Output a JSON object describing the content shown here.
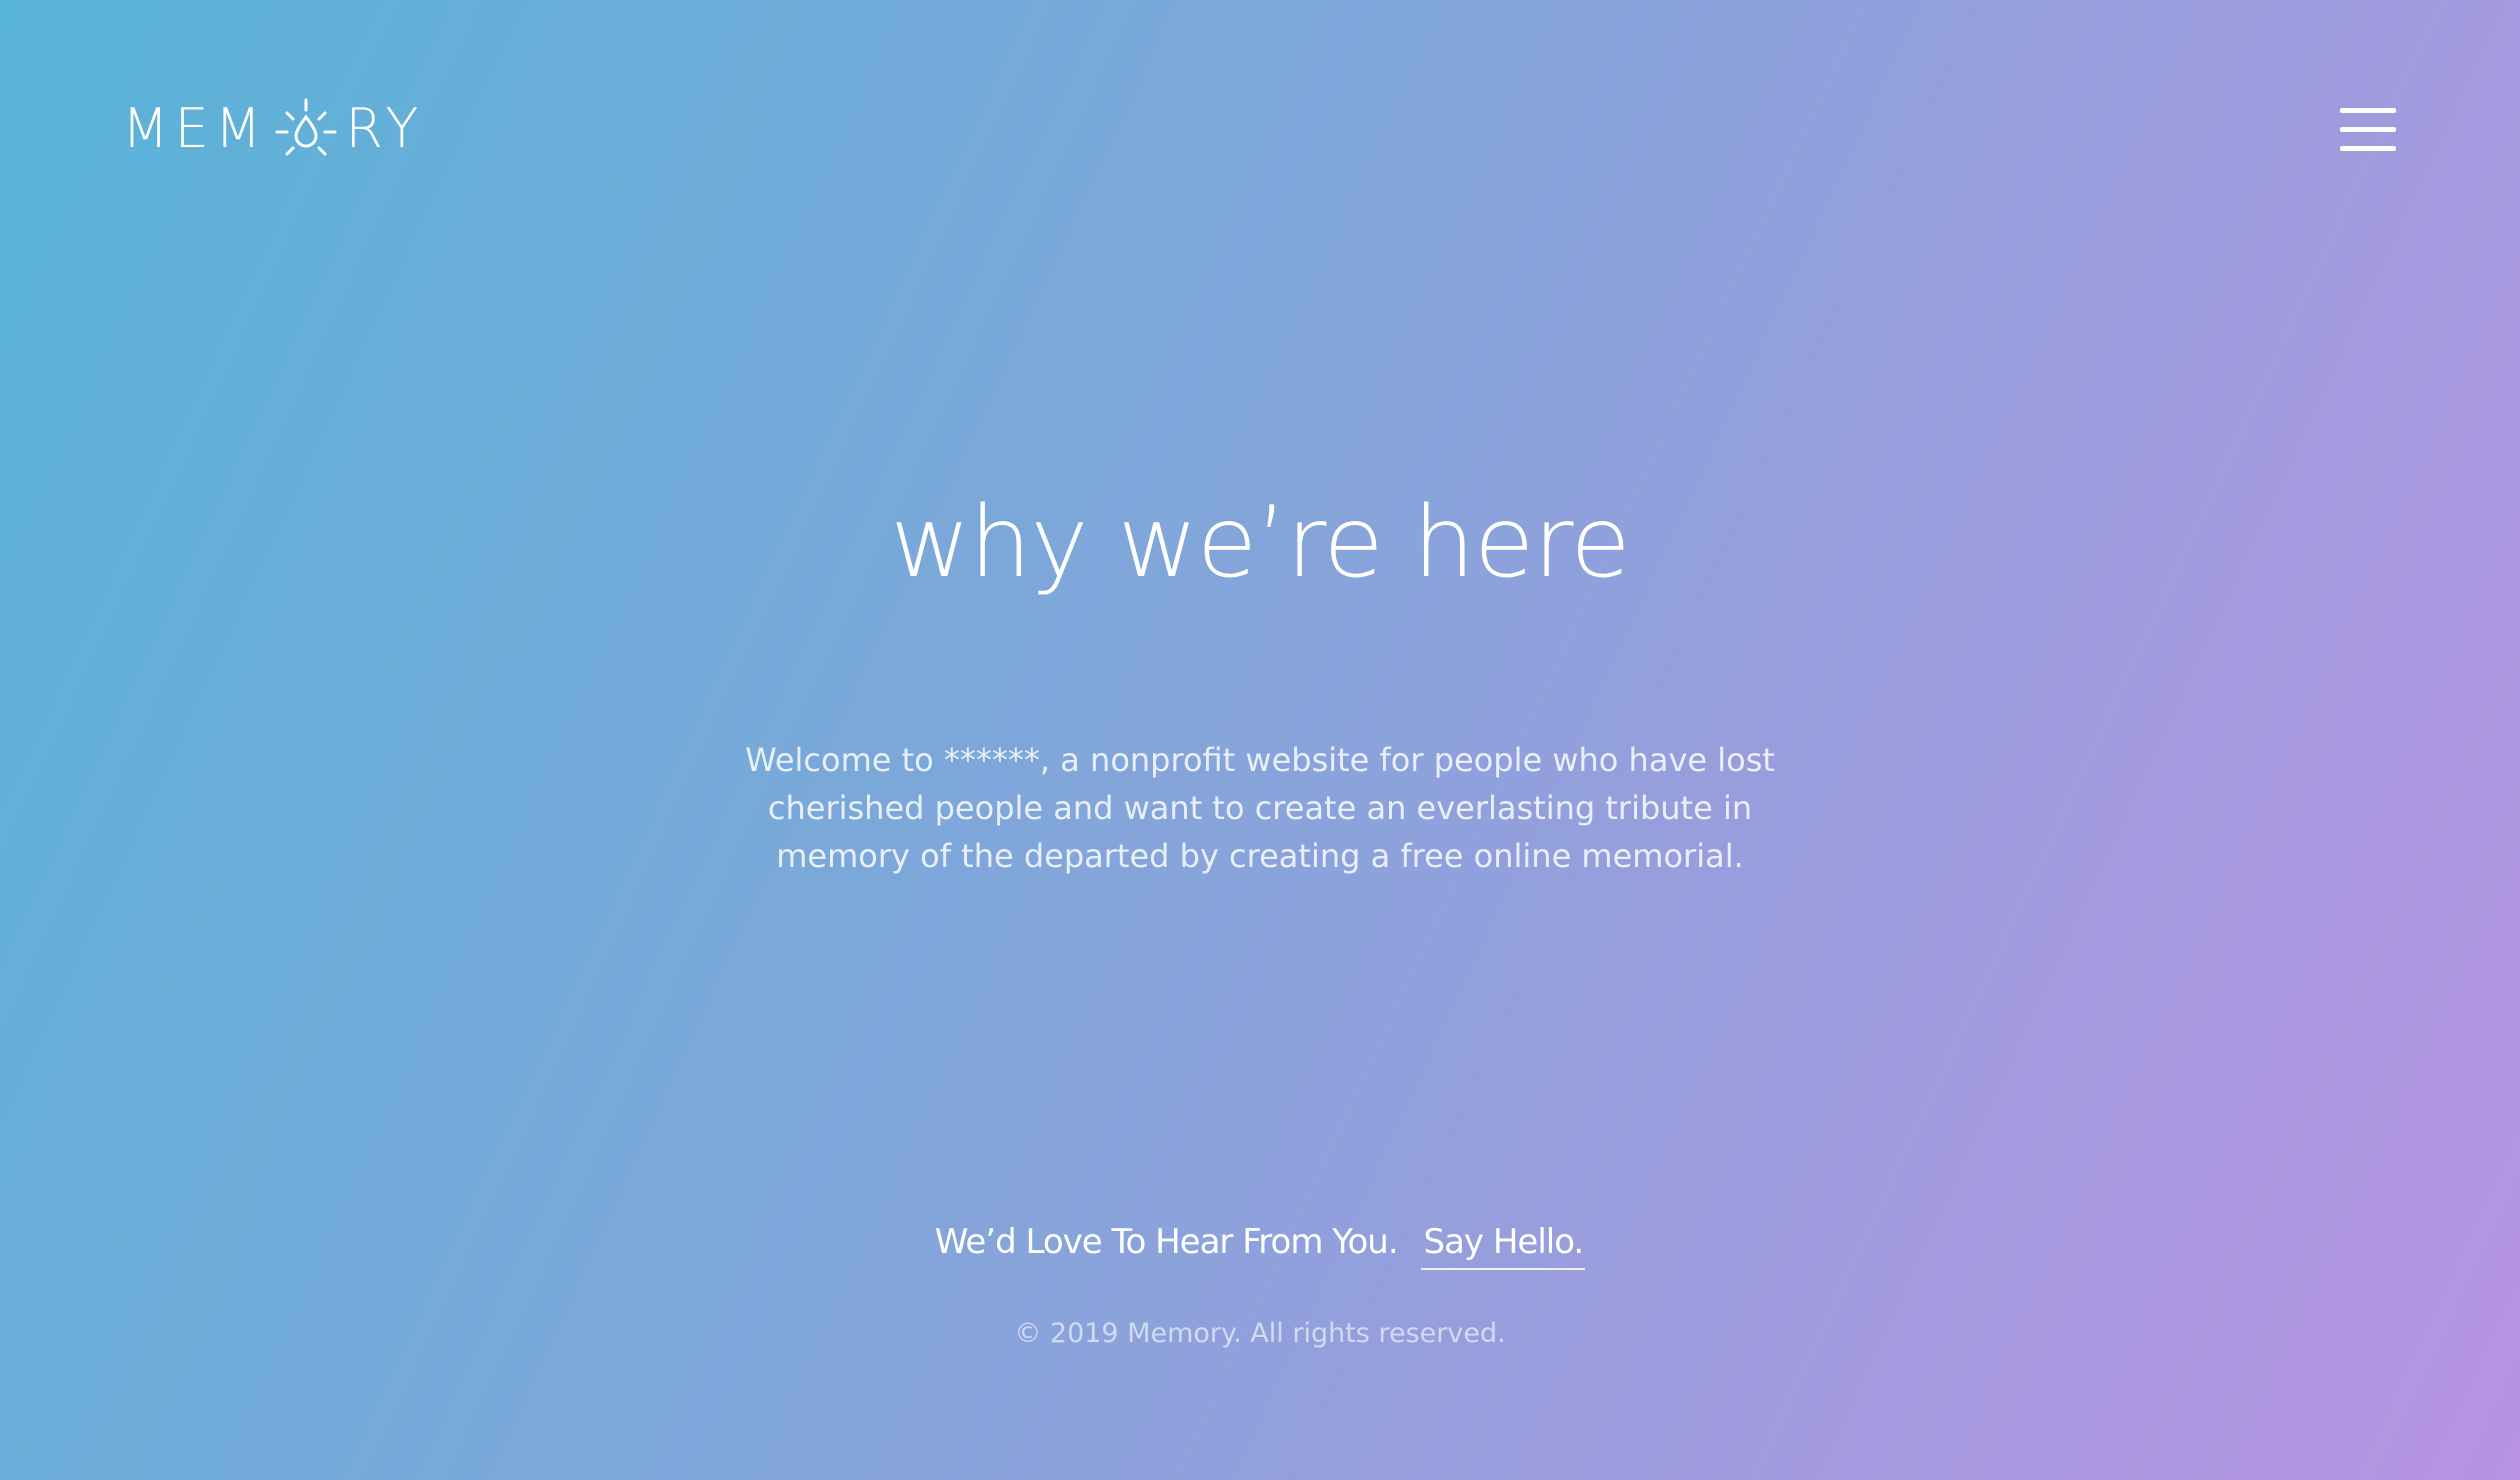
{
  "header": {
    "logo": {
      "text_before": "MEM",
      "text_after": "RY",
      "icon": "lightbulb-icon"
    },
    "menu_icon": "hamburger-menu-icon"
  },
  "hero": {
    "title": "why we’re here",
    "intro": "Welcome to ******, a nonprofit website for people who have lost cherished people and want to create an everlasting tribute in memory of the departed by creating a free online memorial."
  },
  "footer": {
    "contact_lead": "We’d Love To Hear From You.",
    "say_hello_label": "Say Hello.",
    "copyright": "© 2019 Memory. All rights reserved."
  },
  "colors": {
    "gradient_start": "#58b3d8",
    "gradient_end": "#b894e2",
    "text": "#ffffff"
  }
}
